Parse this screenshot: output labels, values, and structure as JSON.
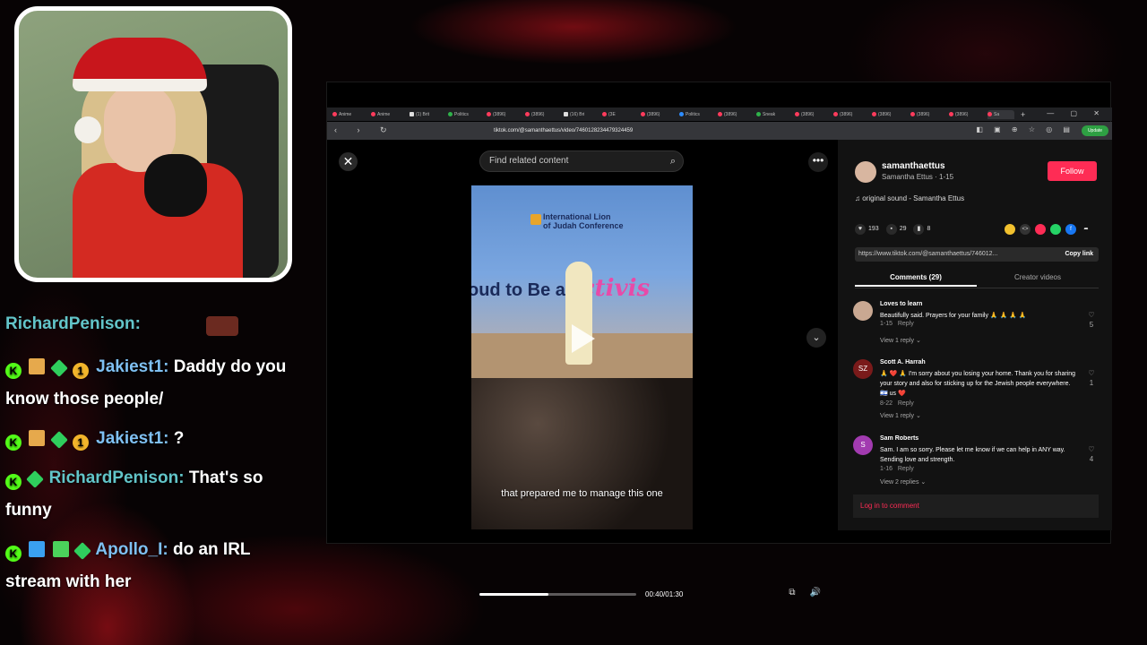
{
  "chat": {
    "top_fragment": "RichardPenison:",
    "messages": [
      {
        "user": "Jakiest1:",
        "text": "Daddy do you know those people/",
        "badges": [
          "k",
          "gift",
          "dia",
          "num"
        ]
      },
      {
        "user": "Jakiest1:",
        "text": "?",
        "badges": [
          "k",
          "gift",
          "dia",
          "num"
        ]
      },
      {
        "user": "RichardPenison:",
        "text": "That's so funny",
        "badges": [
          "k",
          "dia"
        ]
      },
      {
        "user": "Apollo_I:",
        "text": "do an IRL stream with her",
        "badges": [
          "k",
          "sword",
          "bar",
          "dia"
        ]
      }
    ],
    "badge_glyph_num": "1"
  },
  "browser": {
    "tabs": [
      {
        "label": "Anime",
        "icon": "r"
      },
      {
        "label": "Anime",
        "icon": "r"
      },
      {
        "label": "(1) Brit",
        "icon": "x"
      },
      {
        "label": "Politics",
        "icon": "g"
      },
      {
        "label": "(3896)",
        "icon": "r"
      },
      {
        "label": "(3896)",
        "icon": "r"
      },
      {
        "label": "(16) Bri",
        "icon": "x"
      },
      {
        "label": "(3E",
        "icon": "r"
      },
      {
        "label": "(3896)",
        "icon": "r"
      },
      {
        "label": "Politics",
        "icon": "b"
      },
      {
        "label": "(3896)",
        "icon": "r"
      },
      {
        "label": "Sneak",
        "icon": "g"
      },
      {
        "label": "(3896)",
        "icon": "r"
      },
      {
        "label": "(3896)",
        "icon": "r"
      },
      {
        "label": "(3896)",
        "icon": "r"
      },
      {
        "label": "(3896)",
        "icon": "r"
      },
      {
        "label": "(3896)",
        "icon": "r"
      },
      {
        "label": "Sa",
        "icon": "r"
      }
    ],
    "new_tab": "+",
    "window_controls": "— ▢ ✕",
    "nav_icons": "‹ › ↻",
    "url": "tiktok.com/@samanthaettus/video/7460128234479324459",
    "omni_icons": "◧ ▣ ⊕ ☆ ◎ ▤",
    "update_label": "Update"
  },
  "viewer": {
    "close": "✕",
    "search_placeholder": "Find related content",
    "search_icon": "⌕",
    "more": "•••",
    "down": "⌄",
    "video": {
      "conference_line1": "International Lion",
      "conference_line2": "of Judah Conference",
      "banner_left": "oud to Be a",
      "banner_right": "activis",
      "caption": "that prepared me to manage this one"
    },
    "progress": 0.44,
    "timecode": "00:40/01:30",
    "pip_icon": "⧉",
    "volume_icon": "🔊"
  },
  "panel": {
    "handle": "samanthaettus",
    "subtitle": "Samantha Ettus · 1-15",
    "follow": "Follow",
    "sound": "♫  original sound - Samantha Ettus",
    "likes": "193",
    "comments_count": "29",
    "saves": "8",
    "link": "https://www.tiktok.com/@samanthaettus/746012...",
    "copy_link": "Copy link",
    "tab_comments": "Comments (29)",
    "tab_creator": "Creator videos",
    "comments": [
      {
        "name": "Loves to learn",
        "text": "Beautifully said. Prayers for your family 🙏 🙏 🙏 🙏",
        "date": "1-15",
        "reply": "Reply",
        "likes": "5",
        "replies": "View 1 reply ⌄",
        "avatar": ""
      },
      {
        "name": "Scott A. Harrah",
        "text": "🙏 ❤️ 🙏 I'm sorry about you losing your home. Thank you for sharing your story and also for sticking up for the Jewish people everywhere. 🇮🇱 us ❤️",
        "date": "8-22",
        "reply": "Reply",
        "likes": "1",
        "replies": "View 1 reply ⌄",
        "avatar": "SZ"
      },
      {
        "name": "Sam Roberts",
        "text": "Sam. I am so sorry. Please let me know if we can help in ANY way. Sending love and strength.",
        "date": "1-16",
        "reply": "Reply",
        "likes": "4",
        "replies": "View 2 replies ⌄",
        "avatar": "S"
      }
    ],
    "login": "Log in to comment"
  },
  "colors": {
    "accent": "#fe2c55",
    "chat_name": "#62c5c9",
    "kick_green": "#53fc18"
  }
}
